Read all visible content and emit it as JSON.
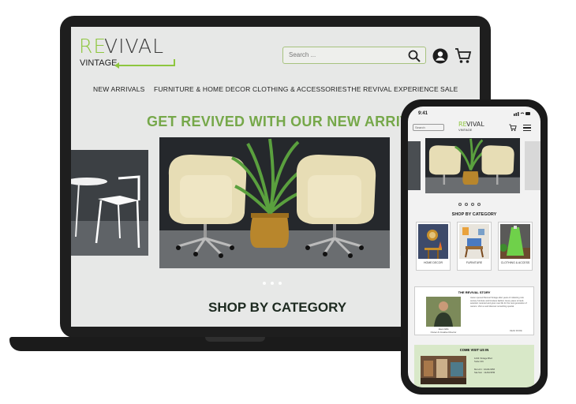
{
  "desktop": {
    "logo": {
      "re": "RE",
      "vival": "VIVAL",
      "vintage": "VINTAGE"
    },
    "search": {
      "placeholder": "Search ..."
    },
    "nav": [
      "NEW ARRIVALS",
      "FURNITURE & HOME DECOR",
      "CLOTHING & ACCESSORIES",
      "THE REVIVAL EXPERIENCE",
      "SALE"
    ],
    "hero_title": "GET REVIVED WITH OUR NEW ARRIVAL",
    "carousel": {
      "slides": 4,
      "active": 1
    },
    "shop_by_category": "SHOP BY CATEGORY"
  },
  "mobile": {
    "status_time": "9:41",
    "search_placeholder": "Search",
    "logo": {
      "re": "RE",
      "vival": "VIVAL",
      "vintage": "VINTAGE"
    },
    "shop_by_category": "SHOP BY CATEGORY",
    "categories": [
      {
        "label": "HOME DECOR"
      },
      {
        "label": "FURNITURE"
      },
      {
        "label": "CLOTHING & ACCESS"
      }
    ],
    "story": {
      "title": "THE REVIVAL STORY",
      "caption": "Jason Ellis",
      "caption2": "Owner & Creative Director",
      "text": "Jason opened Revival Vintage after years of collecting mid-century furniture and timeless fashion. Every piece is hand-selected, restored and given new life for the next generation of owners. Visit us and discover something special.",
      "more": "READ MORE"
    },
    "visit": {
      "title": "COME VISIT US IN",
      "address": "1234 Vintage Blvd\nSuite 101",
      "hours": "Mon-Fri : 10AM-6PM\nSat-Sun : 11AM-5PM"
    }
  },
  "colors": {
    "brand_green": "#8ec63f",
    "title_green": "#76a84a",
    "dark": "#1e1e1e"
  }
}
